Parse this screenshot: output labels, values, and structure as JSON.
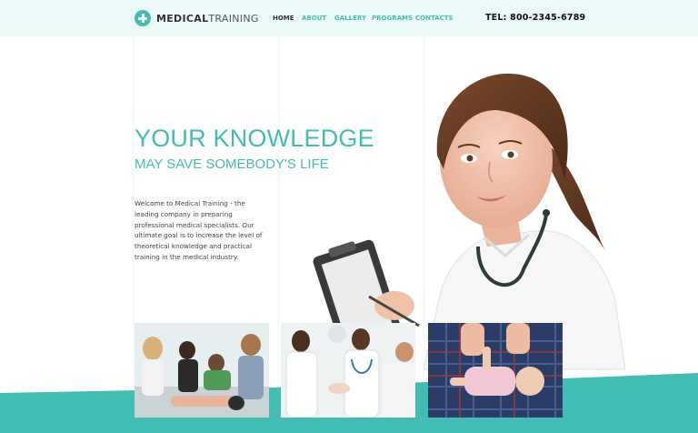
{
  "header": {
    "logo_bold": "MEDICAL",
    "logo_light": "TRAINING",
    "nav": [
      {
        "label": "HOME",
        "active": true
      },
      {
        "label": "ABOUT",
        "active": false
      },
      {
        "label": "GALLERY",
        "active": false
      },
      {
        "label": "PROGRAMS",
        "active": false
      },
      {
        "label": "CONTACTS",
        "active": false
      }
    ],
    "phone": "TEL: 800-2345-6789"
  },
  "hero": {
    "title": "YOUR KNOWLEDGE",
    "subtitle": "MAY SAVE SOMEBODY'S LIFE",
    "text": "Welcome to Medical Training - the leading company in preparing professional medical specialists. Our ultimate goal is to increase the level of theoretical knowledge and practical training in the medical industry."
  },
  "gallery": [
    {
      "name": "cpr-group-training-photo"
    },
    {
      "name": "doctor-patient-photo"
    },
    {
      "name": "infant-cpr-photo"
    }
  ],
  "colors": {
    "accent": "#43bdb3",
    "header_bg": "#ebf8f8",
    "text_dark": "#333333"
  }
}
